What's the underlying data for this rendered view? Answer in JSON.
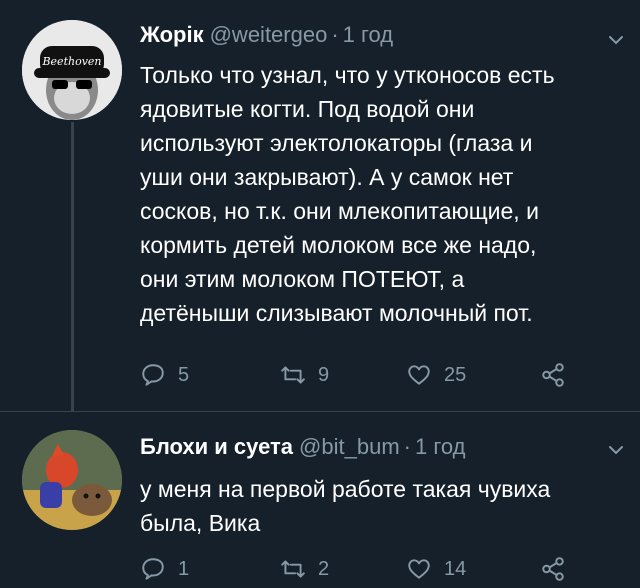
{
  "tweets": [
    {
      "name": "Жорік",
      "handle": "@weitergeo",
      "time": "1 год",
      "avatar_text": "Beethoven",
      "text": "Только что узнал, что у утконосов есть\nядовитые когти. Под водой они\nиспользуют электолокаторы (глаза и\nуши они закрывают). А у самок нет\nсосков, но т.к. они млекопитающие, и\nкормить детей молоком все же надо,\nони этим молоком ПОТЕЮТ, а\nдетёныши слизывают молочный пот.",
      "replies": "5",
      "retweets": "9",
      "likes": "25"
    },
    {
      "name": "Блохи и суета",
      "handle": "@bit_bum",
      "time": "1 год",
      "text": "у меня на первой работе такая чувиха\nбыла, Вика",
      "replies": "1",
      "retweets": "2",
      "likes": "14"
    }
  ],
  "colors": {
    "background": "#15202b",
    "muted": "#8899a6",
    "divider": "#38444d"
  },
  "icons": [
    "reply-icon",
    "retweet-icon",
    "like-icon",
    "share-icon",
    "chevron-down-icon"
  ]
}
